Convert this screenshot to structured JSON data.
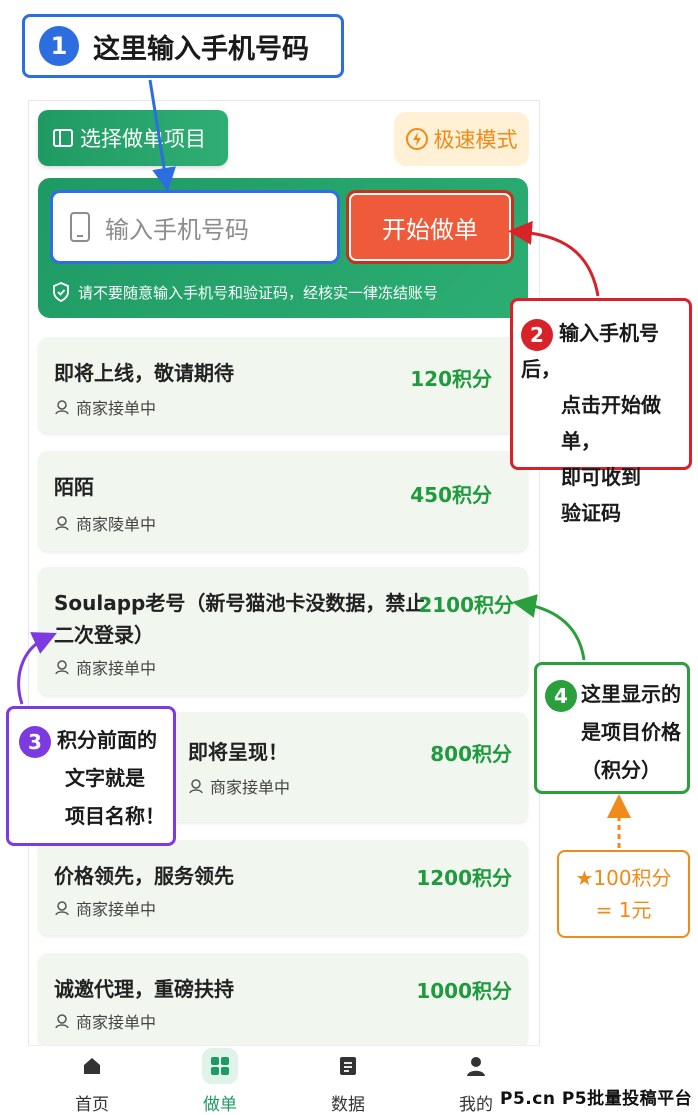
{
  "header": {
    "select_button": "选择做单项目",
    "fast_mode_button": "极速模式"
  },
  "order_panel": {
    "phone_placeholder": "输入手机号码",
    "start_button": "开始做单",
    "warning": "请不要随意输入手机号和验证码，经核实一律冻结账号"
  },
  "items": [
    {
      "title": "即将上线，敬请期待",
      "title2": "",
      "status": "商家接单中",
      "price": "120积分"
    },
    {
      "title": "陌陌",
      "title2": "",
      "status": "商家陵单中",
      "price": "450积分"
    },
    {
      "title": "Soulapp老号（新号猫池卡没数据，禁止",
      "title2": "二次登录）",
      "status": "商家接单中",
      "price": "2100积分"
    },
    {
      "title": "即将呈现！",
      "title2": "",
      "status": "商家接单中",
      "price": "800积分"
    },
    {
      "title": "价格领先，服务领先",
      "title2": "",
      "status": "商家接单中",
      "price": "1200积分"
    },
    {
      "title": "诚邀代理，重磅扶持",
      "title2": "",
      "status": "商家接单中",
      "price": "1000积分"
    }
  ],
  "tabbar": [
    {
      "label": "首页",
      "icon": "home-icon",
      "active": false
    },
    {
      "label": "做单",
      "icon": "grid-icon",
      "active": true
    },
    {
      "label": "数据",
      "icon": "document-icon",
      "active": false
    },
    {
      "label": "我的",
      "icon": "user-icon",
      "active": false
    }
  ],
  "callouts": {
    "c1": {
      "num": "1",
      "text": "这里输入手机号码"
    },
    "c2": {
      "num": "2",
      "line1": "输入手机号后，",
      "line2": "点击开始做单，",
      "line3": "即可收到",
      "line4": "验证码"
    },
    "c3": {
      "num": "3",
      "line1": "积分前面的",
      "line2": "文字就是",
      "line3": "项目名称！"
    },
    "c4": {
      "num": "4",
      "line1": "这里显示的",
      "line2": "是项目价格",
      "line3": "（积分）"
    },
    "c5": {
      "line1": "★100积分",
      "line2": "= 1元"
    }
  },
  "watermark": "P5.cn P5批量投稿平台",
  "colors": {
    "brand_green": "#1f9a63",
    "price_green": "#1f9a3d",
    "start_red": "#ee5a3a",
    "callout_blue": "#2c6de0",
    "callout_red": "#d8222a",
    "callout_purple": "#7c3ae0",
    "callout_green": "#29a03c",
    "callout_orange": "#f08a18"
  }
}
